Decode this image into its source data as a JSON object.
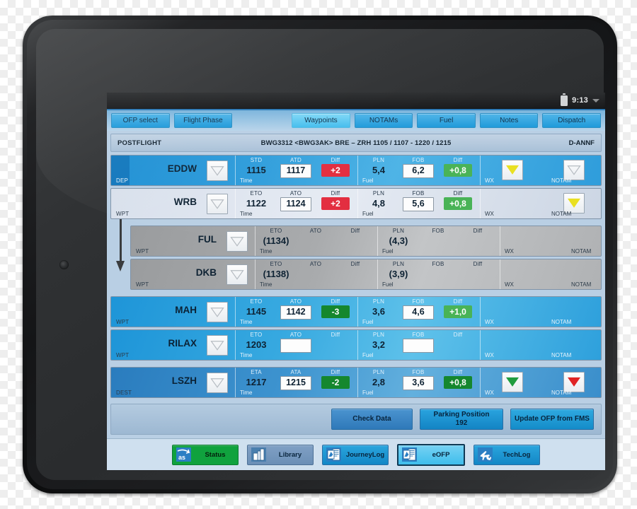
{
  "statusbar": {
    "time": "9:13",
    "battery_icon": "battery-icon",
    "chevron_icon": "chevron-down-icon"
  },
  "tabs": [
    {
      "label": "OFP select",
      "selected": false
    },
    {
      "label": "Flight Phase",
      "selected": false
    },
    {
      "label": "Waypoints",
      "selected": true
    },
    {
      "label": "NOTAMs",
      "selected": false
    },
    {
      "label": "Fuel",
      "selected": false
    },
    {
      "label": "Notes",
      "selected": false
    },
    {
      "label": "Dispatch",
      "selected": false
    }
  ],
  "flight_header": {
    "phase": "POSTFLIGHT",
    "details": "BWG3312  <BWG3AK>  BRE – ZRH  1105 / 1107 - 1220 / 1215",
    "registration": "D-ANNF"
  },
  "rows": [
    {
      "code": "EDDW",
      "type": "DEP",
      "time": {
        "group_label": "Time",
        "h1": "STD",
        "h2": "ATD",
        "h3": "Diff",
        "v1": "1115",
        "v2": "1117",
        "diff": "+2"
      },
      "fuel": {
        "group_label": "Fuel",
        "h1": "PLN",
        "h2": "FOB",
        "h3": "Diff",
        "v1": "5,4",
        "v2": "6,2",
        "diff": "+0,8"
      },
      "flags": {
        "wx_label": "WX",
        "notam_label": "NOTAM",
        "wx": "yellow",
        "notam": "empty"
      }
    },
    {
      "code": "WRB",
      "type": "WPT",
      "time": {
        "group_label": "Time",
        "h1": "ETO",
        "h2": "ATO",
        "h3": "Diff",
        "v1": "1122",
        "v2": "1124",
        "diff": "+2"
      },
      "fuel": {
        "group_label": "Fuel",
        "h1": "PLN",
        "h2": "FOB",
        "h3": "Diff",
        "v1": "4,8",
        "v2": "5,6",
        "diff": "+0,8"
      },
      "flags": {
        "wx_label": "WX",
        "notam_label": "NOTAM",
        "wx": "empty",
        "notam": "yellow"
      }
    },
    {
      "code": "FUL",
      "type": "WPT",
      "time": {
        "group_label": "Time",
        "h1": "ETO",
        "h2": "ATO",
        "h3": "Diff",
        "v1": "(1134)",
        "v2": "",
        "diff": ""
      },
      "fuel": {
        "group_label": "Fuel",
        "h1": "PLN",
        "h2": "FOB",
        "h3": "Diff",
        "v1": "(4,3)",
        "v2": "",
        "diff": ""
      },
      "flags": {
        "wx_label": "WX",
        "notam_label": "NOTAM",
        "wx": "none",
        "notam": "none"
      }
    },
    {
      "code": "DKB",
      "type": "WPT",
      "time": {
        "group_label": "Time",
        "h1": "ETO",
        "h2": "ATO",
        "h3": "Diff",
        "v1": "(1138)",
        "v2": "",
        "diff": ""
      },
      "fuel": {
        "group_label": "Fuel",
        "h1": "PLN",
        "h2": "FOB",
        "h3": "Diff",
        "v1": "(3,9)",
        "v2": "",
        "diff": ""
      },
      "flags": {
        "wx_label": "WX",
        "notam_label": "NOTAM",
        "wx": "none",
        "notam": "none"
      }
    },
    {
      "code": "MAH",
      "type": "WPT",
      "time": {
        "group_label": "Time",
        "h1": "ETO",
        "h2": "ATO",
        "h3": "Diff",
        "v1": "1145",
        "v2": "1142",
        "diff": "-3"
      },
      "fuel": {
        "group_label": "Fuel",
        "h1": "PLN",
        "h2": "FOB",
        "h3": "Diff",
        "v1": "3,6",
        "v2": "4,6",
        "diff": "+1,0"
      },
      "flags": {
        "wx_label": "WX",
        "notam_label": "NOTAM",
        "wx": "none",
        "notam": "none"
      }
    },
    {
      "code": "RILAX",
      "type": "WPT",
      "time": {
        "group_label": "Time",
        "h1": "ETO",
        "h2": "ATO",
        "h3": "Diff",
        "v1": "1203",
        "v2": "",
        "diff": ""
      },
      "fuel": {
        "group_label": "Fuel",
        "h1": "PLN",
        "h2": "FOB",
        "h3": "Diff",
        "v1": "3,2",
        "v2": "",
        "diff": ""
      },
      "flags": {
        "wx_label": "WX",
        "notam_label": "NOTAM",
        "wx": "none",
        "notam": "none"
      }
    },
    {
      "code": "LSZH",
      "type": "DEST",
      "time": {
        "group_label": "Time",
        "h1": "ETA",
        "h2": "ATA",
        "h3": "Diff",
        "v1": "1217",
        "v2": "1215",
        "diff": "-2"
      },
      "fuel": {
        "group_label": "Fuel",
        "h1": "PLN",
        "h2": "FOB",
        "h3": "Diff",
        "v1": "2,8",
        "v2": "3,6",
        "diff": "+0,8"
      },
      "flags": {
        "wx_label": "WX",
        "notam_label": "NOTAM",
        "wx": "green",
        "notam": "red"
      }
    }
  ],
  "actions": {
    "check_data": "Check Data",
    "parking_label": "Parking Position",
    "parking_value": "192",
    "update_ofp": "Update OFP from FMS"
  },
  "footer": [
    {
      "label": "Status",
      "icon": "as-logo-icon",
      "style": "green",
      "selected": false
    },
    {
      "label": "Library",
      "icon": "library-books-icon",
      "style": "muted",
      "selected": false
    },
    {
      "label": "JourneyLog",
      "icon": "journey-log-icon",
      "style": "std",
      "selected": false
    },
    {
      "label": "eOFP",
      "icon": "eofp-document-icon",
      "style": "sel",
      "selected": true
    },
    {
      "label": "TechLog",
      "icon": "plane-wrench-icon",
      "style": "std",
      "selected": false
    }
  ],
  "colors": {
    "accent_blue": "#1e9ada",
    "selected_tab": "#43bdee",
    "diff_negative": "#e32d3f",
    "diff_positive": "#49b356",
    "diff_positive_dark": "#15872e",
    "flag_yellow": "#e9e021",
    "flag_green": "#1f9c3e",
    "flag_red": "#e02424",
    "status_green": "#10a23e"
  }
}
